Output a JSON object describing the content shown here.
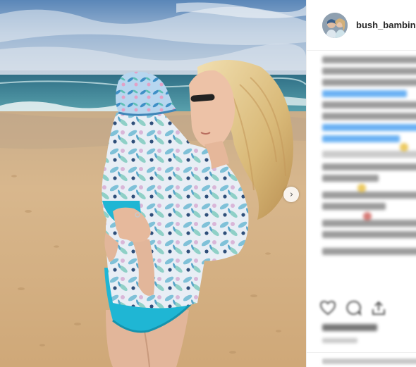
{
  "post": {
    "username": "bush_bambinis",
    "carousel_next_glyph": "›",
    "icons": {
      "next": "chevron-right-icon",
      "like": "heart-icon",
      "comment": "comment-icon",
      "share": "share-icon"
    }
  },
  "colors": {
    "link_blue": "#3897f0",
    "swimsuit_turquoise": "#1fb6d4",
    "sea": "#3e8fa0",
    "sand": "#d7b58a"
  }
}
